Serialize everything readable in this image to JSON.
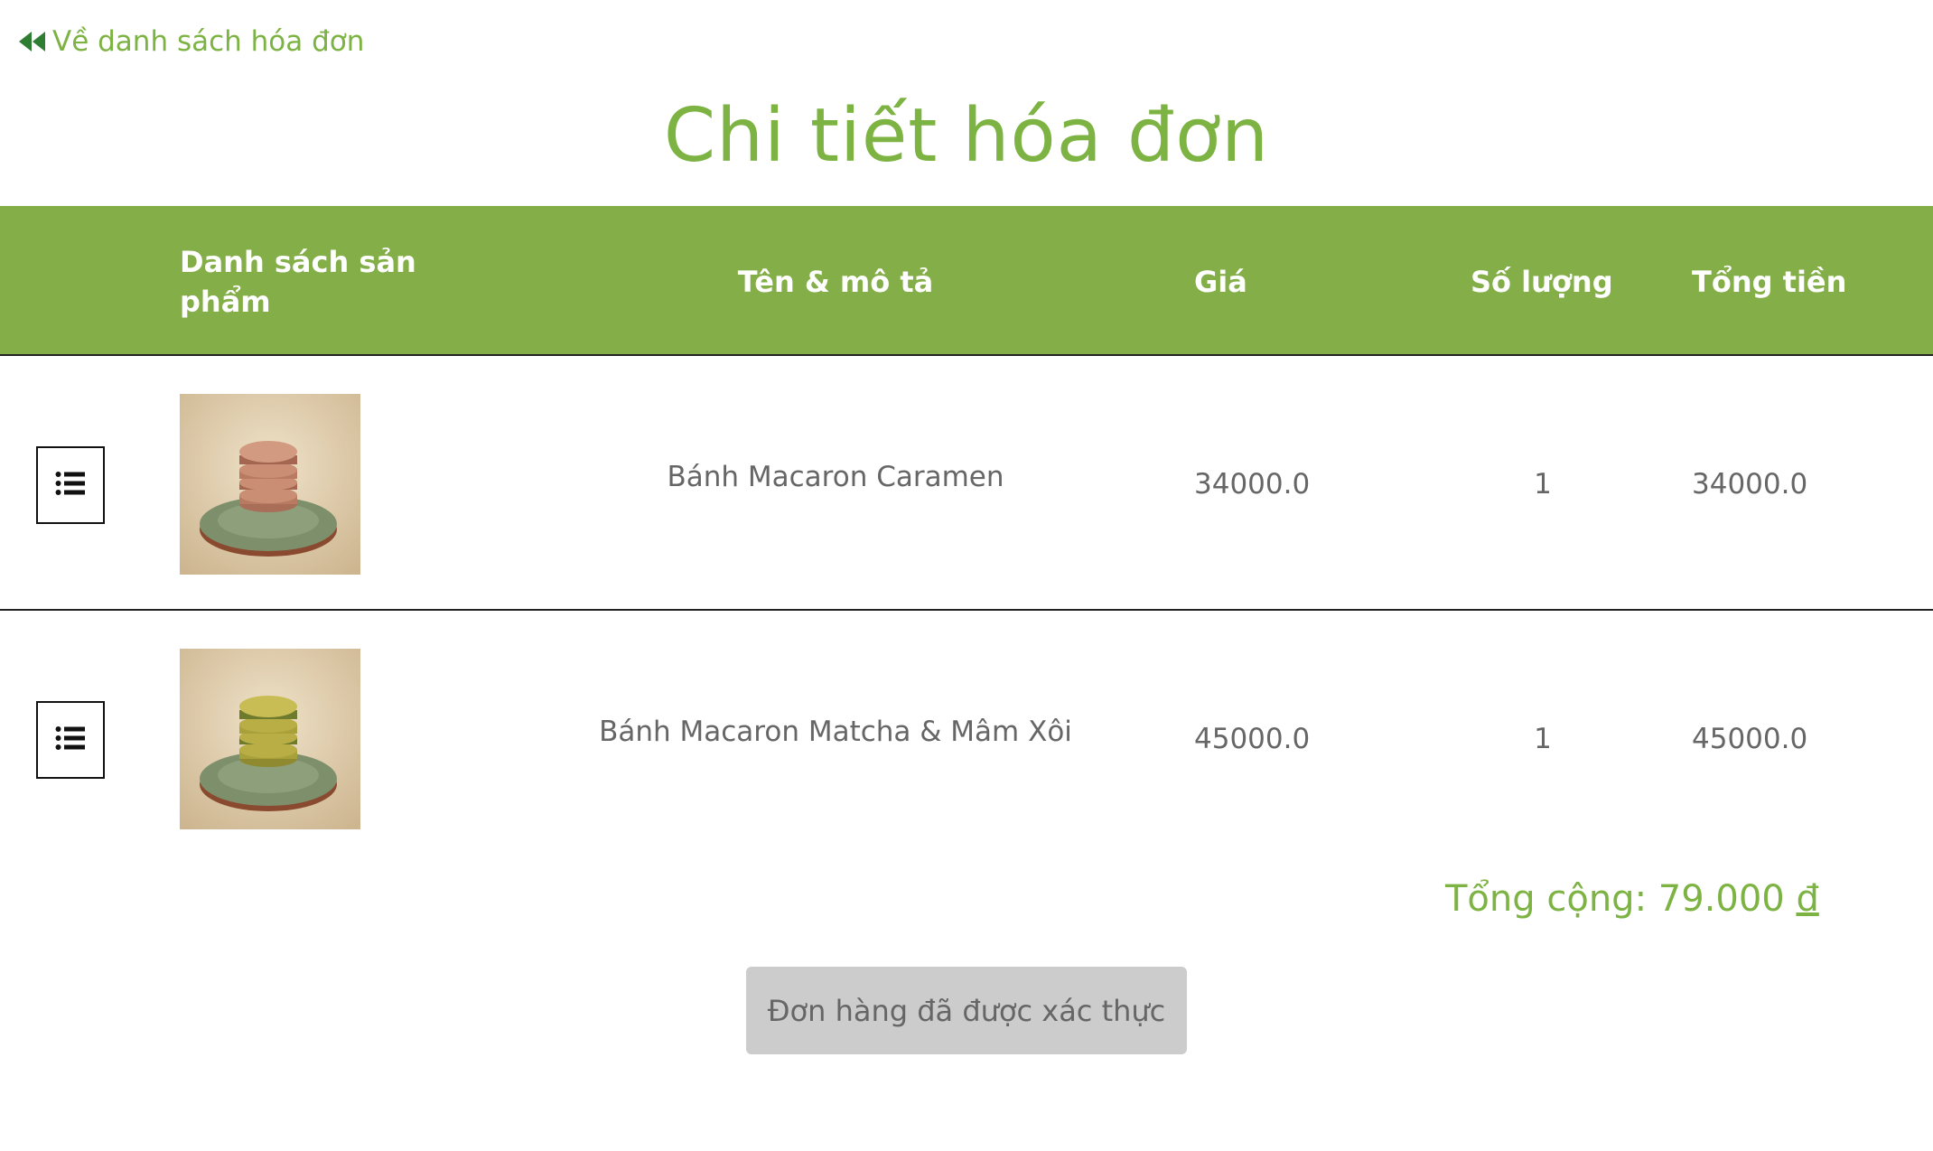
{
  "nav": {
    "back_label": "Về danh sách hóa đơn"
  },
  "page": {
    "title": "Chi tiết hóa đơn"
  },
  "table": {
    "headers": {
      "list": "Danh sách sản phẩm",
      "name": "Tên & mô tả",
      "price": "Giá",
      "quantity": "Số lượng",
      "total": "Tổng tiền"
    },
    "rows": [
      {
        "name": "Bánh Macaron Caramen",
        "price": "34000.0",
        "quantity": "1",
        "total": "34000.0",
        "thumbnail": "macaron-caramel-image",
        "macaron_color": "#c98e74"
      },
      {
        "name": "Bánh Macaron Matcha & Mâm Xôi",
        "price": "45000.0",
        "quantity": "1",
        "total": "45000.0",
        "thumbnail": "macaron-matcha-image",
        "macaron_color": "#b9ad45"
      }
    ]
  },
  "summary": {
    "total_label": "Tổng cộng: 79.000",
    "currency": "đ"
  },
  "status_button": {
    "label": "Đơn hàng đã được xác thực"
  },
  "colors": {
    "brand_green": "#7cb342",
    "header_green": "#84ae48",
    "button_gray": "#cccccc"
  }
}
